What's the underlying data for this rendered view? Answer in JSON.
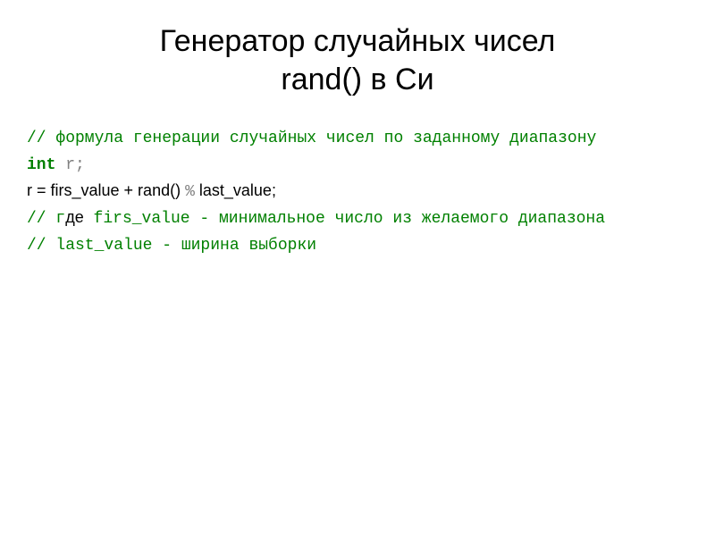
{
  "slide": {
    "title_line1": "Генератор случайных чисел",
    "title_line2": "rand() в Си",
    "code": {
      "comment1": "// формула генерации случайных чисел по заданному диапазону",
      "decl_keyword": "int",
      "decl_var": " r",
      "decl_semi": ";",
      "formula_prefix": " r = firs_value + rand() ",
      "formula_percent": "%",
      "formula_suffix": " last_value;",
      "comment2_a": "// г",
      "comment2_b": "де",
      "comment2_c": " firs_value - минимальное число из желаемого диапазона",
      "comment3": "// last_value - ширина выборки"
    }
  }
}
